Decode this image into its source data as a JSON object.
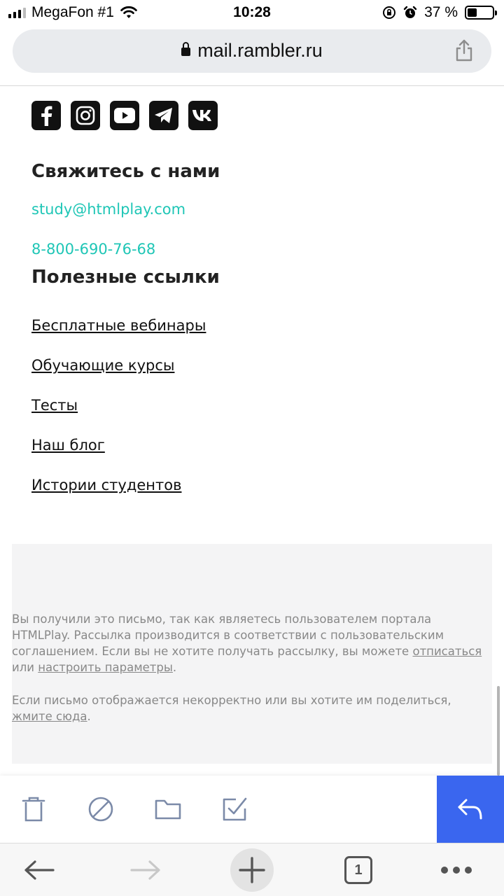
{
  "status_bar": {
    "carrier": "MegaFon #1",
    "time": "10:28",
    "battery_percent_label": "37 %",
    "battery_level": 0.37
  },
  "browser": {
    "url": "mail.rambler.ru"
  },
  "social_icons": [
    "facebook-icon",
    "instagram-icon",
    "youtube-icon",
    "telegram-icon",
    "vk-icon"
  ],
  "contact": {
    "heading": "Свяжитесь с нами",
    "email": "study@htmlplay.com",
    "phone": "8-800-690-76-68"
  },
  "useful_links": {
    "heading": "Полезные ссылки",
    "items": [
      "Бесплатные вебинары",
      "Обучающие курсы",
      "Тесты",
      "Наш блог",
      "Истории студентов"
    ]
  },
  "footer": {
    "notice_text": "Вы получили это письмо, так как являетесь пользователем портала HTMLPlay. Рассылка производится в соответствии с пользовательским соглашением. Если вы не хотите получать рассылку, вы можете",
    "unsubscribe_link": "отписаться",
    "or_text": "или",
    "settings_link": "настроить параметры",
    "period": ".",
    "display_text": "Если письмо отображается некорректно или вы хотите им поделиться,",
    "click_here_link": "жмите сюда"
  },
  "mail_toolbar": {
    "icons": [
      "trash-icon",
      "spam-icon",
      "folder-icon",
      "mark-read-icon"
    ],
    "reply_icon": "reply-icon",
    "accent": "#3a66ef"
  },
  "browser_toolbar": {
    "tab_count": "1",
    "icons": [
      "back-arrow-icon",
      "forward-arrow-icon",
      "new-tab-plus-icon",
      "tabs-icon",
      "more-icon"
    ]
  },
  "colors": {
    "link_teal": "#1fc6b6",
    "footer_gray": "#f4f4f5"
  }
}
